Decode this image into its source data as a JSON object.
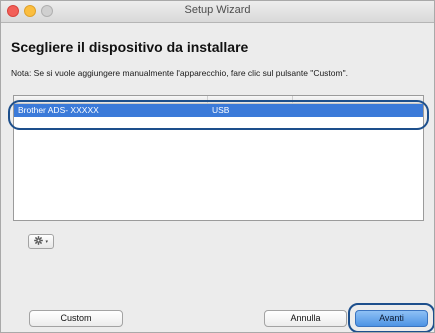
{
  "window": {
    "title": "Setup Wizard"
  },
  "heading": "Scegliere il dispositivo da installare",
  "note": "Nota: Se si vuole aggiungere manualmente l'apparecchio, fare clic sul pulsante \"Custom\".",
  "device_table": {
    "rows": [
      {
        "name": "Brother ADS- XXXXX",
        "connection": "USB"
      }
    ]
  },
  "action_menu": {
    "icon": "gear-icon",
    "arrow": "▾"
  },
  "buttons": {
    "custom": "Custom",
    "cancel": "Annulla",
    "next": "Avanti"
  },
  "colors": {
    "selection": "#3b7ad9",
    "default_button": "#4e93e4",
    "callout": "#1d4f8c"
  }
}
